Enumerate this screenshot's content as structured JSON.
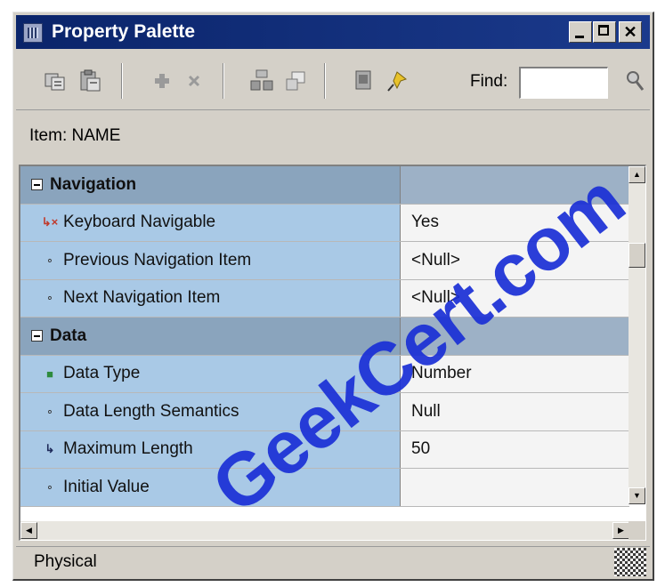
{
  "window": {
    "title": "Property Palette"
  },
  "toolbar": {
    "find_label": "Find:",
    "find_value": "",
    "icons": [
      "copy-properties-icon",
      "paste-properties-icon",
      "add-property-icon",
      "delete-property-icon",
      "property-union-icon",
      "property-intersection-icon",
      "inherit-icon",
      "freeze-pin-icon",
      "search-icon"
    ]
  },
  "item": {
    "label": "Item: NAME"
  },
  "properties": {
    "rows": [
      {
        "type": "section",
        "name": "Navigation",
        "value": ""
      },
      {
        "type": "prop",
        "icon": "changed-flag-icon",
        "name": "Keyboard Navigable",
        "value": "Yes"
      },
      {
        "type": "prop",
        "icon": "default-dot-icon",
        "name": "Previous Navigation Item",
        "value": "<Null>"
      },
      {
        "type": "prop",
        "icon": "default-dot-icon",
        "name": "Next Navigation Item",
        "value": "<Null>"
      },
      {
        "type": "section",
        "name": "Data",
        "value": ""
      },
      {
        "type": "prop",
        "icon": "default-square-icon",
        "name": "Data Type",
        "value": "Number"
      },
      {
        "type": "prop",
        "icon": "default-dot-icon",
        "name": "Data Length Semantics",
        "value": "Null"
      },
      {
        "type": "prop",
        "icon": "inherited-arrow-icon",
        "name": "Maximum Length",
        "value": "50"
      },
      {
        "type": "prop",
        "icon": "default-dot-icon",
        "name": "Initial Value",
        "value": ""
      }
    ]
  },
  "status": {
    "category": "Physical"
  },
  "watermark": {
    "text": "GeekCert.com"
  },
  "colors": {
    "titlebar": "#0a246a",
    "name_column": "#a9c9e6",
    "section_row": "#8aa4bd",
    "watermark": "#1a2fd6"
  }
}
